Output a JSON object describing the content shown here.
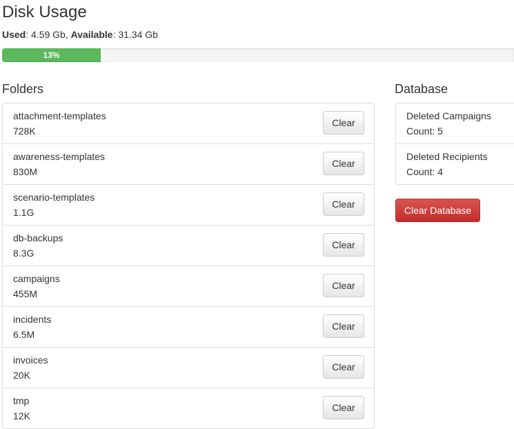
{
  "page_title": "Disk Usage",
  "usage": {
    "used_label": "Used",
    "used_value": ": 4.59 Gb, ",
    "available_label": "Available",
    "available_value": ": 31.34 Gb",
    "percent_text": "13%",
    "percent": 13,
    "bar_color": "#5cb85c"
  },
  "folders": {
    "heading": "Folders",
    "clear_label": "Clear",
    "items": [
      {
        "name": "attachment-templates",
        "size": "728K"
      },
      {
        "name": "awareness-templates",
        "size": "830M"
      },
      {
        "name": "scenario-templates",
        "size": "1.1G"
      },
      {
        "name": "db-backups",
        "size": "8.3G"
      },
      {
        "name": "campaigns",
        "size": "455M"
      },
      {
        "name": "incidents",
        "size": "6.5M"
      },
      {
        "name": "invoices",
        "size": "20K"
      },
      {
        "name": "tmp",
        "size": "12K"
      }
    ]
  },
  "database": {
    "heading": "Database",
    "items": [
      {
        "label": "Deleted Campaigns",
        "count": "Count: 5"
      },
      {
        "label": "Deleted Recipients",
        "count": "Count: 4"
      }
    ],
    "clear_button": "Clear Database",
    "danger_color": "#d9534f"
  }
}
